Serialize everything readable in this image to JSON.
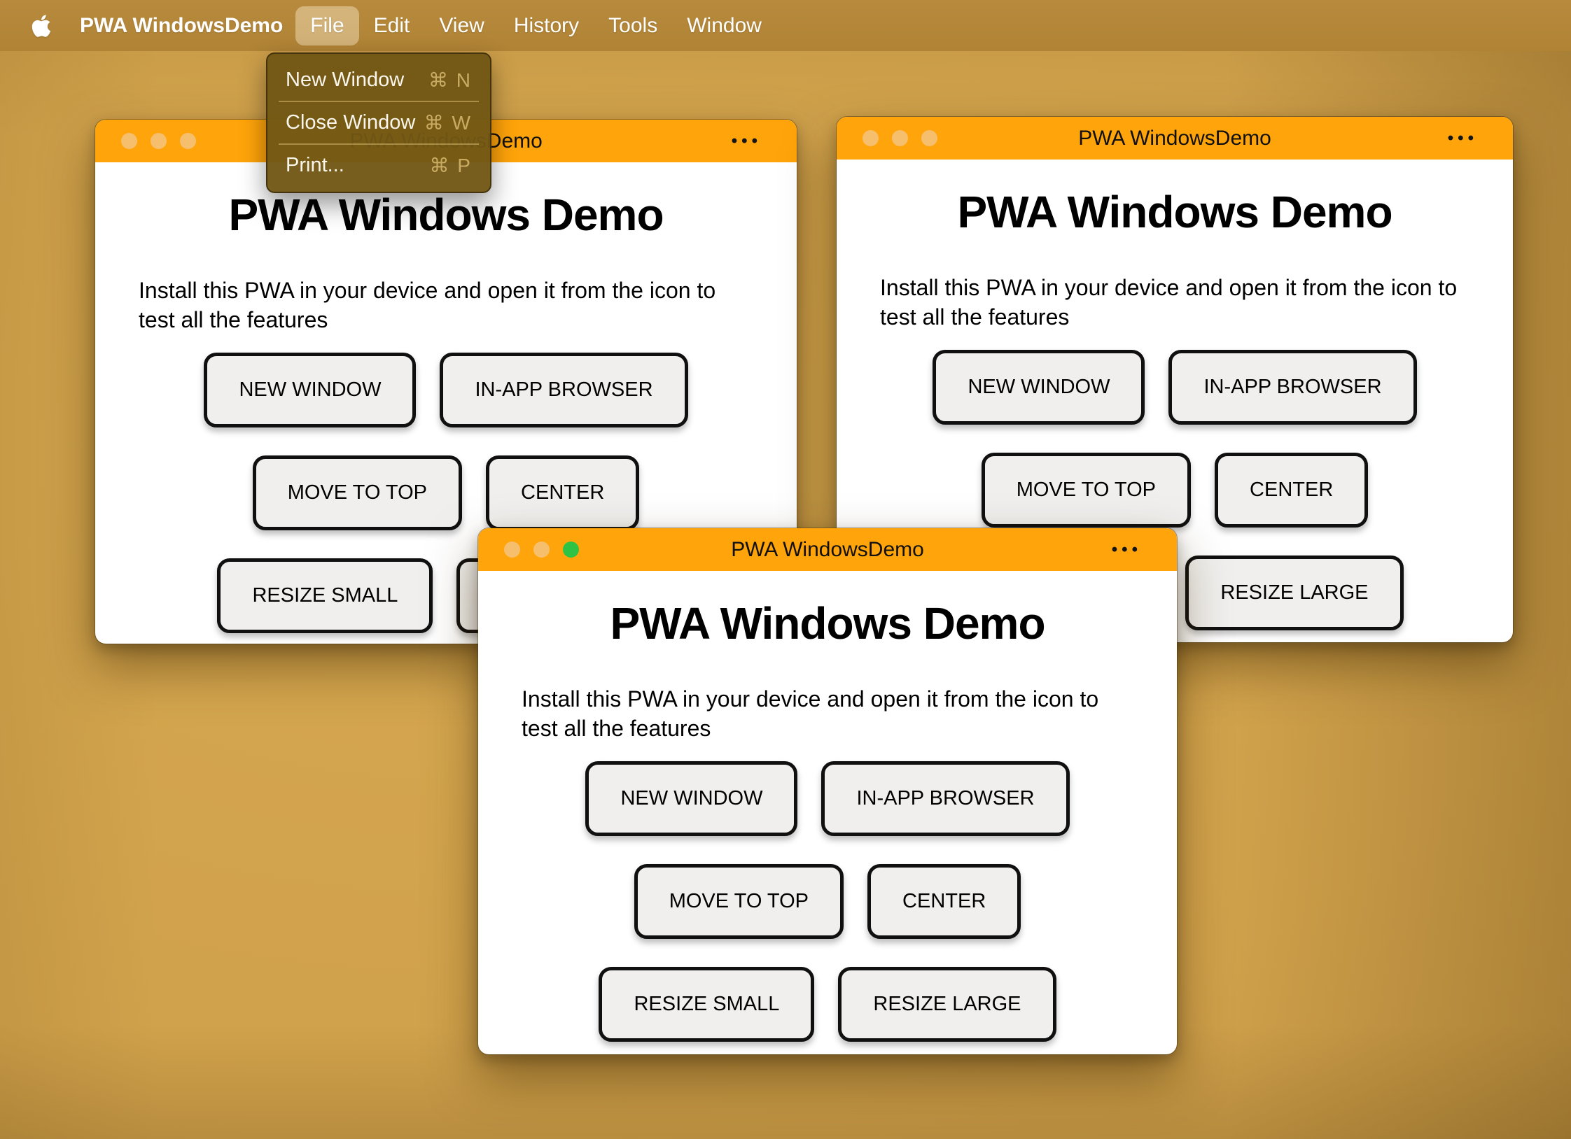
{
  "menubar": {
    "app_name": "PWA WindowsDemo",
    "items": [
      {
        "label": "File",
        "active": true
      },
      {
        "label": "Edit",
        "active": false
      },
      {
        "label": "View",
        "active": false
      },
      {
        "label": "History",
        "active": false
      },
      {
        "label": "Tools",
        "active": false
      },
      {
        "label": "Window",
        "active": false
      }
    ]
  },
  "file_menu": {
    "items": [
      {
        "label": "New Window",
        "shortcut": "⌘ N"
      },
      {
        "label": "Close Window",
        "shortcut": "⌘ W"
      },
      {
        "label": "Print...",
        "shortcut": "⌘ P"
      }
    ]
  },
  "window": {
    "title": "PWA WindowsDemo",
    "more_button": "•••",
    "heading": "PWA Windows Demo",
    "description": "Install this PWA in your device and open it from the icon to test all the features",
    "buttons": {
      "new_window": "NEW WINDOW",
      "in_app_browser": "IN-APP BROWSER",
      "move_to_top": "MOVE TO TOP",
      "center": "CENTER",
      "resize_small": "RESIZE SMALL",
      "resize_large": "RESIZE LARGE"
    }
  },
  "colors": {
    "titlebar_orange": "#ffa40a",
    "desktop_tan": "#d0a14b",
    "menubar_tan": "#b5873a",
    "dropdown_brown": "#715715",
    "shortcut_gold": "#c9ab63",
    "traffic_light_inactive": "#f6bf6e",
    "traffic_light_green": "#2fc346",
    "button_bg": "#f0efed"
  }
}
